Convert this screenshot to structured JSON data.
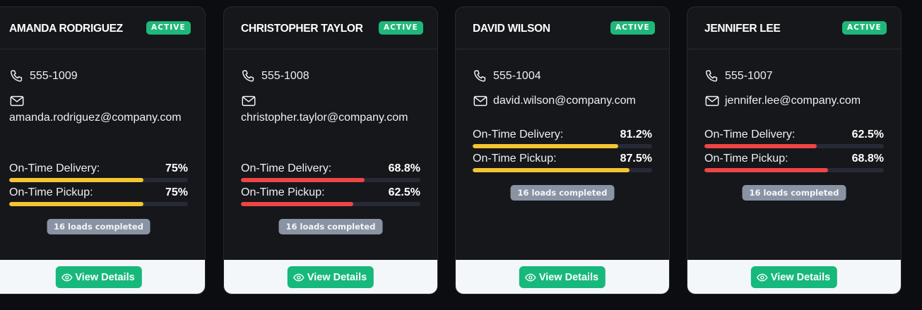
{
  "colors": {
    "active_badge": "#1fb77a",
    "bar_yellow": "#f5c431",
    "bar_red": "#ef4444",
    "bar_track": "#262a36",
    "button": "#17b87c",
    "loads_badge": "#8a93a4"
  },
  "cards": [
    {
      "name": "AMANDA RODRIGUEZ",
      "status": "ACTIVE",
      "phone": "555-1009",
      "phone_icon": "phone-icon",
      "email_icon": "mail-icon",
      "email": "amanda.rodriguez@company.com",
      "delivery_label": "On-Time Delivery:",
      "delivery_value": "75%",
      "delivery_pct": 75,
      "delivery_color": "yellow",
      "pickup_label": "On-Time Pickup:",
      "pickup_value": "75%",
      "pickup_pct": 75,
      "pickup_color": "yellow",
      "loads": "16 loads completed",
      "button_label": "View Details",
      "button_icon": "eye-icon"
    },
    {
      "name": "CHRISTOPHER TAYLOR",
      "status": "ACTIVE",
      "phone": "555-1008",
      "phone_icon": "phone-icon",
      "email_icon": "mail-icon",
      "email": "christopher.taylor@company.com",
      "delivery_label": "On-Time Delivery:",
      "delivery_value": "68.8%",
      "delivery_pct": 68.8,
      "delivery_color": "red",
      "pickup_label": "On-Time Pickup:",
      "pickup_value": "62.5%",
      "pickup_pct": 62.5,
      "pickup_color": "red",
      "loads": "16 loads completed",
      "button_label": "View Details",
      "button_icon": "eye-icon"
    },
    {
      "name": "DAVID WILSON",
      "status": "ACTIVE",
      "phone": "555-1004",
      "phone_icon": "phone-icon",
      "email_icon": "mail-icon",
      "email": "david.wilson@company.com",
      "delivery_label": "On-Time Delivery:",
      "delivery_value": "81.2%",
      "delivery_pct": 81.2,
      "delivery_color": "yellow",
      "pickup_label": "On-Time Pickup:",
      "pickup_value": "87.5%",
      "pickup_pct": 87.5,
      "pickup_color": "yellow",
      "loads": "16 loads completed",
      "button_label": "View Details",
      "button_icon": "eye-icon"
    },
    {
      "name": "JENNIFER LEE",
      "status": "ACTIVE",
      "phone": "555-1007",
      "phone_icon": "phone-icon",
      "email_icon": "mail-icon",
      "email": "jennifer.lee@company.com",
      "delivery_label": "On-Time Delivery:",
      "delivery_value": "62.5%",
      "delivery_pct": 62.5,
      "delivery_color": "red",
      "pickup_label": "On-Time Pickup:",
      "pickup_value": "68.8%",
      "pickup_pct": 68.8,
      "pickup_color": "red",
      "loads": "16 loads completed",
      "button_label": "View Details",
      "button_icon": "eye-icon"
    }
  ]
}
